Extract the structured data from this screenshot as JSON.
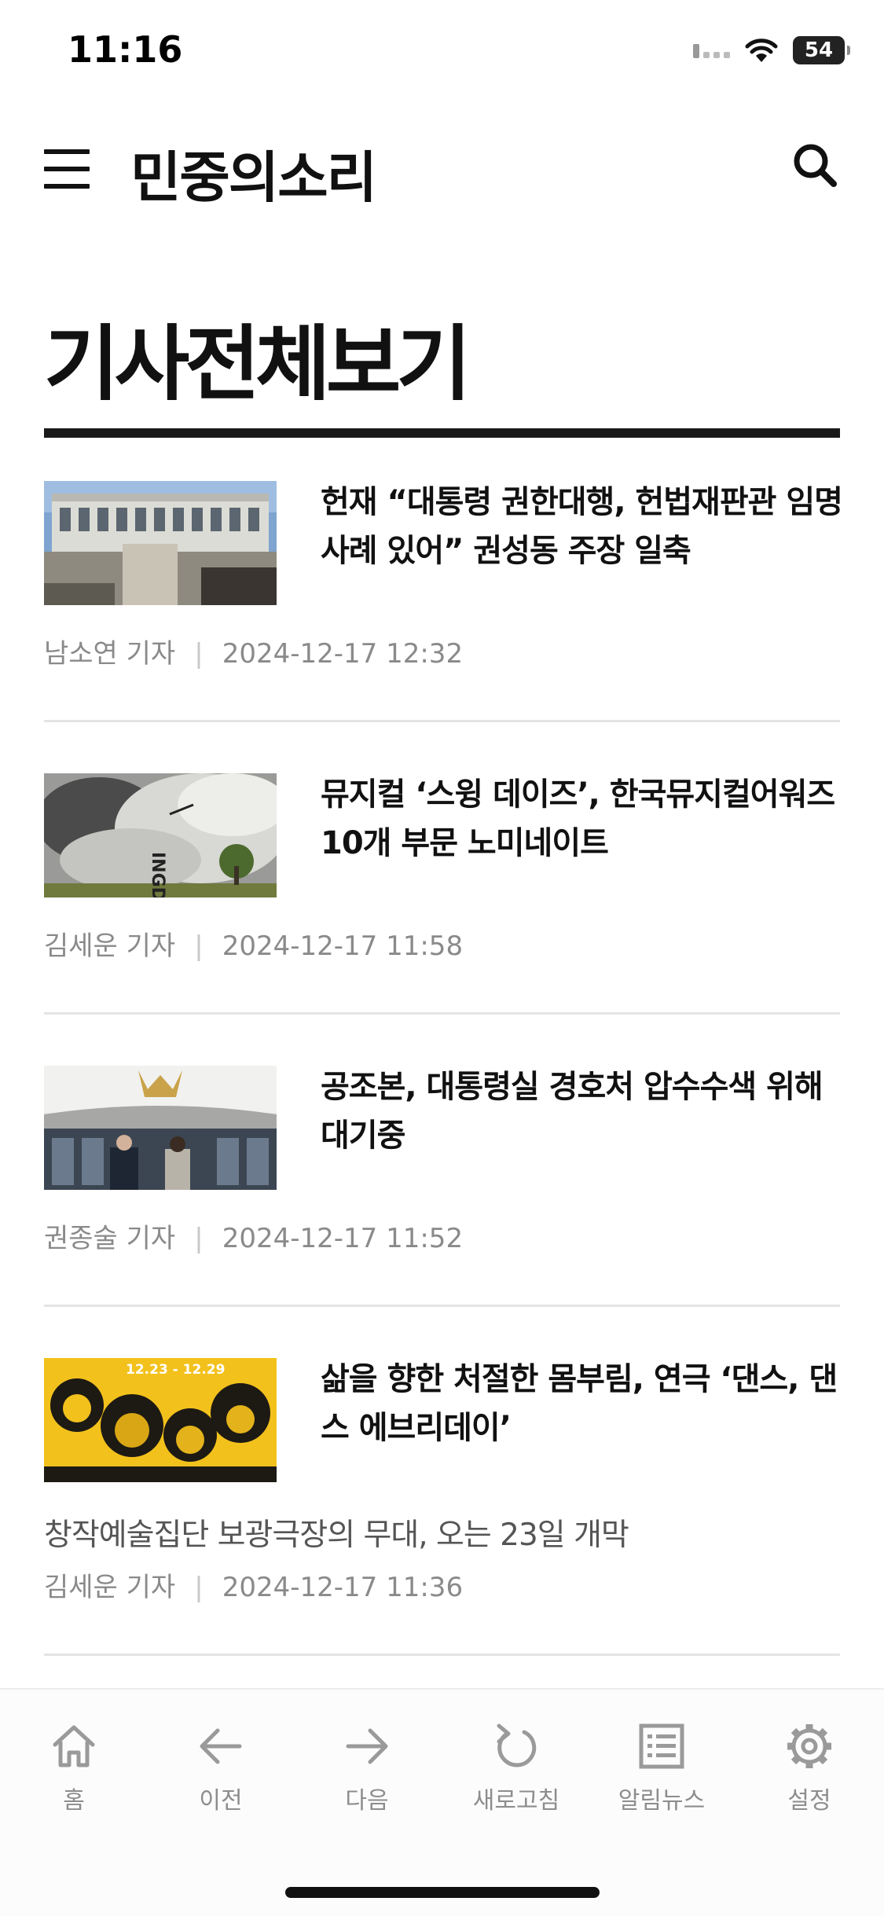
{
  "status_bar": {
    "time": "11:16",
    "battery": "54"
  },
  "header": {
    "brand": "민중의소리"
  },
  "page_title": "기사전체보기",
  "articles": [
    {
      "headline": "헌재 “대통령 권한대행, 헌법재판관 임명 사례 있어” 권성동 주장 일축",
      "subtitle": "",
      "author": "남소연 기자",
      "date": "2024-12-17 12:32"
    },
    {
      "headline": "뮤지컬 ‘스윙 데이즈’, 한국뮤지컬어워즈 10개 부문 노미네이트",
      "subtitle": "",
      "author": "김세운 기자",
      "date": "2024-12-17 11:58"
    },
    {
      "headline": "공조본, 대통령실 경호처 압수수색 위해 대기중",
      "subtitle": "",
      "author": "권종술 기자",
      "date": "2024-12-17 11:52"
    },
    {
      "headline": "삶을 향한 처절한 몸부림, 연극 ‘댄스, 댄스 에브리데이’",
      "subtitle": "창작예술집단 보광극장의 무대, 오는 23일 개막",
      "author": "김세운 기자",
      "date": "2024-12-17 11:36",
      "poster_text": "12.23 - 12.29"
    }
  ],
  "meta_separator": "|",
  "bottom_nav": [
    {
      "label": "홈",
      "icon": "home-icon"
    },
    {
      "label": "이전",
      "icon": "arrow-left-icon"
    },
    {
      "label": "다음",
      "icon": "arrow-right-icon"
    },
    {
      "label": "새로고침",
      "icon": "refresh-icon"
    },
    {
      "label": "알림뉴스",
      "icon": "list-icon"
    },
    {
      "label": "설정",
      "icon": "gear-icon"
    }
  ]
}
